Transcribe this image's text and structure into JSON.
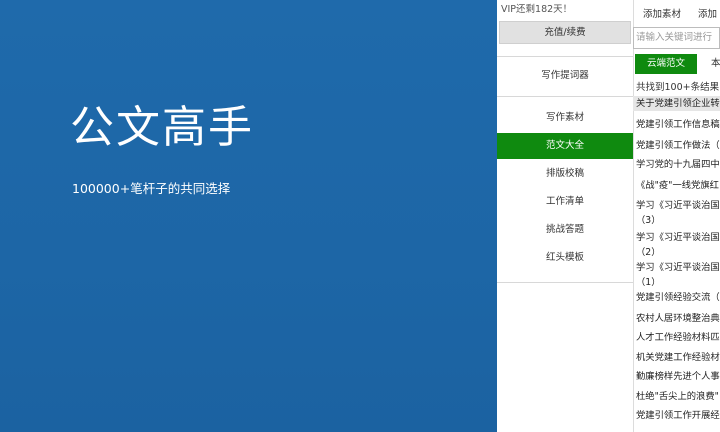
{
  "hero": {
    "title": "公文高手",
    "subtitle": "100000+笔杆子的共同选择"
  },
  "sidebar": {
    "vip_status": "VIP还剩182天！",
    "recharge_label": "充值/续费",
    "items": [
      {
        "label": "写作提词器"
      },
      {
        "label": "写作素材"
      },
      {
        "label": "范文大全"
      },
      {
        "label": "排版校稿"
      },
      {
        "label": "工作清单"
      },
      {
        "label": "挑战答题"
      },
      {
        "label": "红头模板"
      }
    ],
    "active_index": 2
  },
  "toolbar": {
    "add_material": "添加素材",
    "add_other": "添加"
  },
  "search": {
    "placeholder": "请输入关键词进行"
  },
  "tabs": {
    "active": "云端范文",
    "second": "本"
  },
  "results": {
    "count_text": "共找到100+条结果",
    "items": [
      {
        "lines": [
          "关于党建引领企业转"
        ],
        "header": true
      },
      {
        "lines": [
          "党建引领工作信息稿"
        ]
      },
      {
        "lines": [
          "党建引领工作做法（"
        ]
      },
      {
        "lines": [
          "学习党的十九届四中"
        ]
      },
      {
        "lines": [
          "《战\"疫\"一线党旗红"
        ]
      },
      {
        "lines": [
          "学习《习近平谈治国",
          "（3）"
        ]
      },
      {
        "lines": [
          "学习《习近平谈治国",
          "（2）"
        ]
      },
      {
        "lines": [
          "学习《习近平谈治国",
          "（1）"
        ]
      },
      {
        "lines": [
          "党建引领经验交流（"
        ]
      },
      {
        "lines": [
          "农村人居环境整治典"
        ]
      },
      {
        "lines": [
          "人才工作经验材料匹"
        ]
      },
      {
        "lines": [
          "机关党建工作经验材"
        ]
      },
      {
        "lines": [
          "勤廉榜样先进个人事"
        ]
      },
      {
        "lines": [
          "杜绝\"舌尖上的浪费\""
        ]
      },
      {
        "lines": [
          "党建引领工作开展经"
        ]
      }
    ]
  },
  "colors": {
    "hero_background": "#1e67a8",
    "active_green": "#0f8a0f"
  }
}
